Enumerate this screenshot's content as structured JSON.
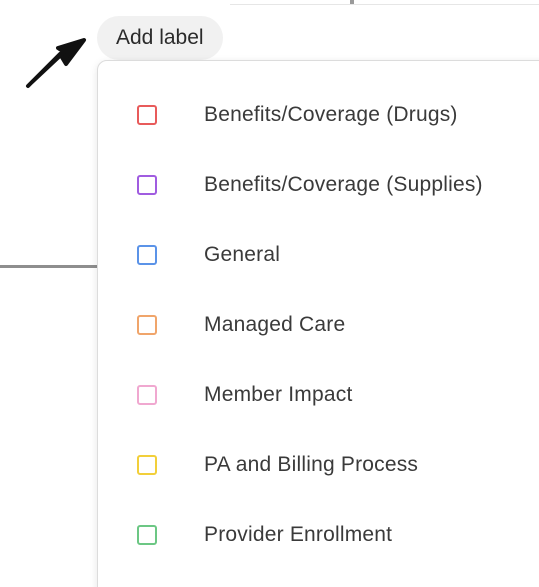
{
  "chip": {
    "label": "Add label"
  },
  "dropdown": {
    "items": [
      {
        "label": "Benefits/Coverage (Drugs)",
        "color": "#e85b5b"
      },
      {
        "label": "Benefits/Coverage (Supplies)",
        "color": "#a05ce0"
      },
      {
        "label": "General",
        "color": "#5b93e8"
      },
      {
        "label": "Managed Care",
        "color": "#f0a56b"
      },
      {
        "label": "Member Impact",
        "color": "#f0a8d0"
      },
      {
        "label": "PA and Billing Process",
        "color": "#f2cf3a"
      },
      {
        "label": "Provider Enrollment",
        "color": "#6cc784"
      }
    ]
  },
  "icons": {
    "pointer": "arrow-pointer-icon"
  }
}
